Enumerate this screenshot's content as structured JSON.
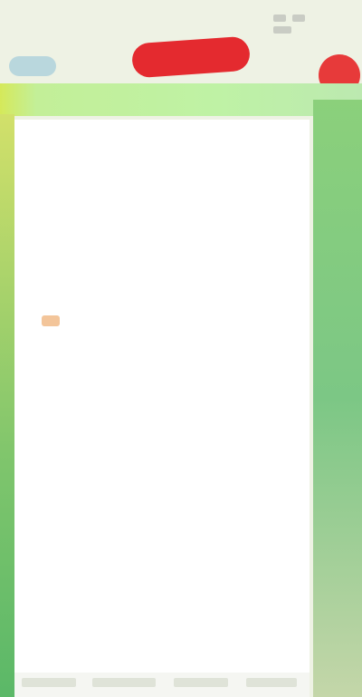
{
  "status": {
    "time": ""
  },
  "header": {
    "back_label": "",
    "promo_label": "",
    "corner_label": ""
  },
  "details": [
    {
      "label": "",
      "value": ""
    },
    {
      "label": "",
      "value": ""
    },
    {
      "label": "",
      "value": ""
    },
    {
      "label": "",
      "value": ""
    },
    {
      "label": "",
      "value": ""
    },
    {
      "label": "",
      "value": ""
    },
    {
      "label": "",
      "value": ""
    },
    {
      "label": "",
      "value": ""
    },
    {
      "label": "",
      "value": ""
    },
    {
      "label": "",
      "value": ""
    },
    {
      "label": "",
      "value": ""
    },
    {
      "label": "",
      "value": ""
    },
    {
      "label": "",
      "value": ""
    },
    {
      "label": "",
      "value": ""
    },
    {
      "label": "",
      "value": ""
    }
  ],
  "colors": {
    "accent_red": "#e42a2f",
    "banner_green": "#bff2a5",
    "link_blue": "#6b8fc2"
  }
}
